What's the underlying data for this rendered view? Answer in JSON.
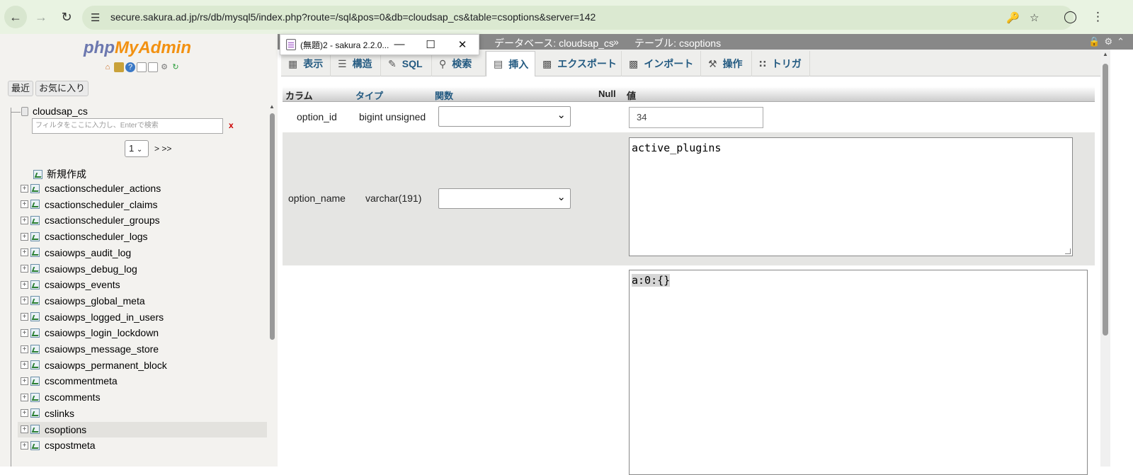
{
  "browser": {
    "url": "secure.sakura.ad.jp/rs/db/mysql5/index.php?route=/sql&pos=0&db=cloudsap_cs&table=csoptions&server=142"
  },
  "notepad": {
    "title": "(無題)2 - sakura 2.2.0..."
  },
  "left_panel": {
    "logo_php": "php",
    "logo_my": "MyAdmin",
    "recent_label": "最近",
    "favorites_label": "お気に入り",
    "db_name": "cloudsap_cs",
    "filter_placeholder": "フィルタをここに入力し、Enterで検索",
    "filter_clear": "x",
    "page_value": "1",
    "page_next": "> >>",
    "new_label": "新規作成",
    "tables": [
      "csactionscheduler_actions",
      "csactionscheduler_claims",
      "csactionscheduler_groups",
      "csactionscheduler_logs",
      "csaiowps_audit_log",
      "csaiowps_debug_log",
      "csaiowps_events",
      "csaiowps_global_meta",
      "csaiowps_logged_in_users",
      "csaiowps_login_lockdown",
      "csaiowps_message_store",
      "csaiowps_permanent_block",
      "cscommentmeta",
      "cscomments",
      "cslinks",
      "csoptions",
      "cspostmeta"
    ],
    "selected_table": "csoptions"
  },
  "header": {
    "db_crumb": "データベース: cloudsap_cs",
    "separator": "»",
    "table_crumb": "テーブル: csoptions"
  },
  "tabs": [
    {
      "label": "表示",
      "icon": "browse-icon"
    },
    {
      "label": "構造",
      "icon": "structure-icon"
    },
    {
      "label": "SQL",
      "icon": "sql-icon"
    },
    {
      "label": "検索",
      "icon": "search-icon"
    },
    {
      "label": "挿入",
      "icon": "insert-icon",
      "active": true
    },
    {
      "label": "エクスポート",
      "icon": "export-icon"
    },
    {
      "label": "インポート",
      "icon": "import-icon"
    },
    {
      "label": "操作",
      "icon": "operations-icon"
    },
    {
      "label": "トリガ",
      "icon": "triggers-icon"
    }
  ],
  "insert_table": {
    "headers": {
      "column": "カラム",
      "type": "タイプ",
      "function": "関数",
      "null": "Null",
      "value": "値"
    },
    "rows": [
      {
        "name": "option_id",
        "type": "bigint unsigned",
        "value": "34"
      },
      {
        "name": "option_name",
        "type": "varchar(191)",
        "value": "active_plugins"
      },
      {
        "name": "",
        "type": "",
        "value": "a:0:{}"
      }
    ]
  }
}
